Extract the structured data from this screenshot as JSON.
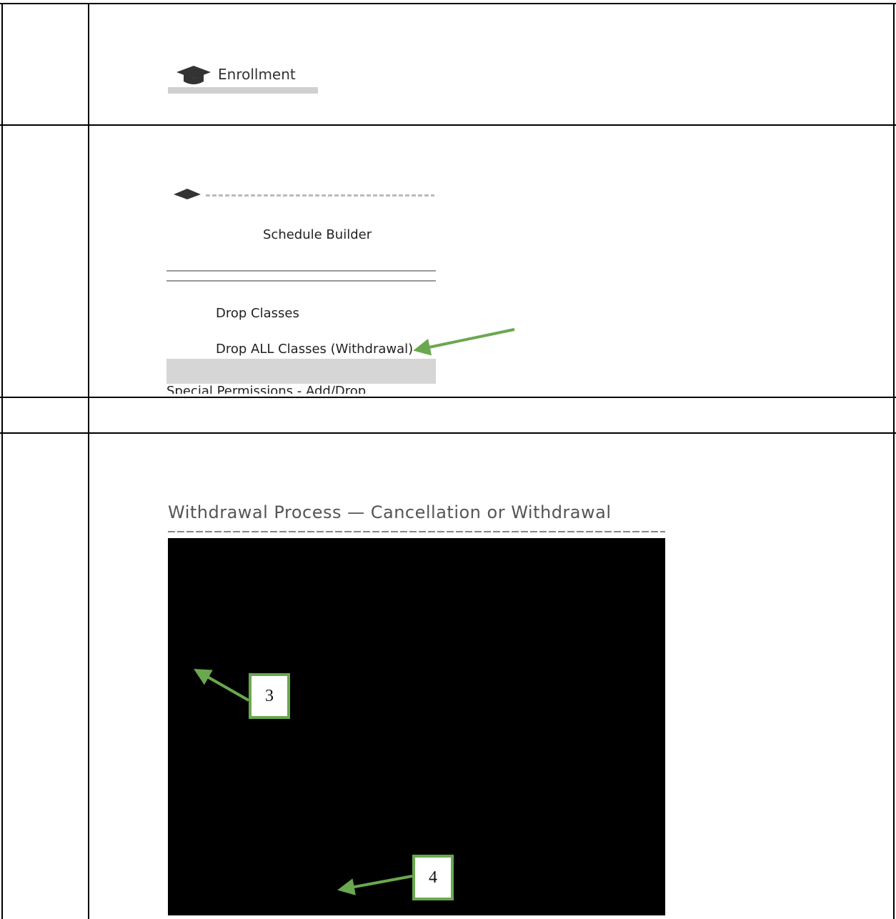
{
  "enrollment_tile": {
    "label": "Enrollment",
    "icon": "graduation-cap-icon"
  },
  "enrollment_menu": {
    "items": [
      "Schedule Builder",
      "Drop Classes",
      "Drop ALL Classes (Withdrawal)",
      "Special Permissions - Add/Drop"
    ]
  },
  "withdrawal_page": {
    "heading": "Withdrawal Process — Cancellation or Withdrawal"
  },
  "callouts": {
    "step_3": "3",
    "step_4": "4"
  },
  "colors": {
    "arrow": "#6aa84f",
    "grid": "#000000",
    "highlight_band": "#d6d6d6"
  }
}
